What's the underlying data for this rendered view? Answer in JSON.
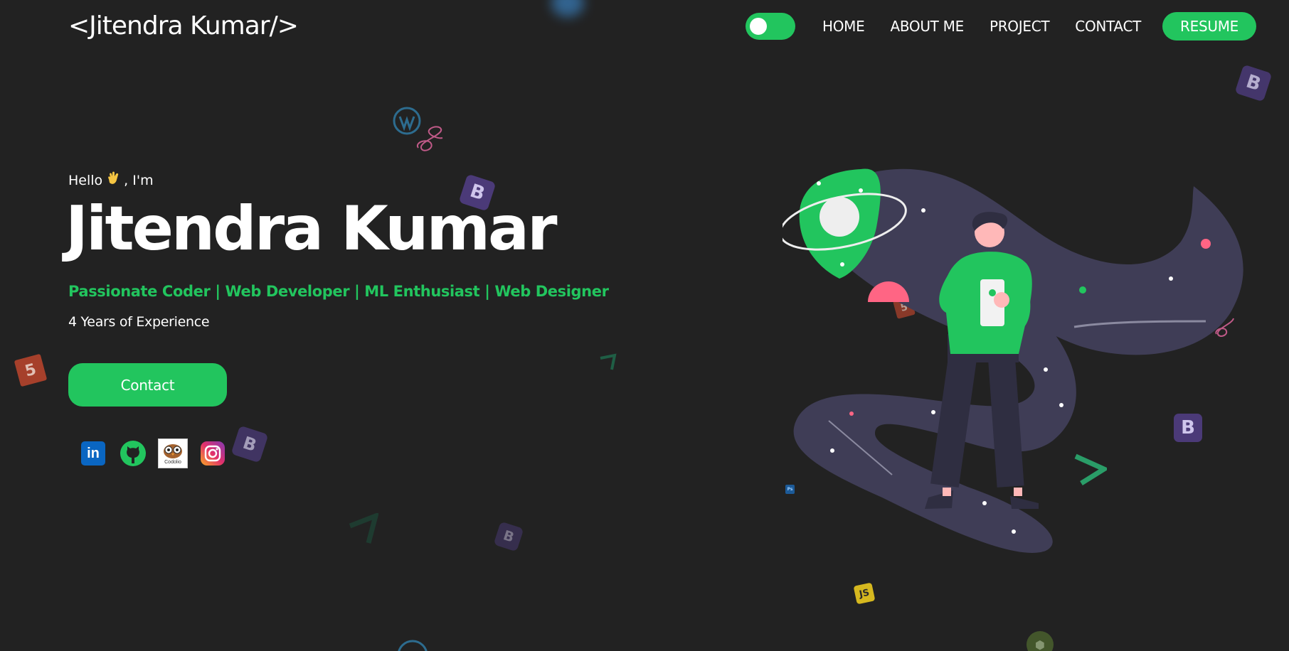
{
  "header": {
    "logo": "<Jitendra Kumar/>",
    "nav_items": [
      "HOME",
      "ABOUT ME",
      "PROJECT",
      "CONTACT"
    ],
    "resume_label": "RESUME"
  },
  "hero": {
    "greeting_prefix": "Hello",
    "greeting_suffix": ", I'm",
    "name": "Jitendra Kumar",
    "tagline": "Passionate Coder | Web Developer | ML Enthusiast | Web Designer",
    "experience": "4 Years of Experience",
    "contact_label": "Contact"
  },
  "socials": {
    "linkedin_glyph": "in",
    "codolio_label": "Codolio"
  },
  "floating_icons": {
    "bootstrap": "B",
    "html5": "5",
    "javascript": "JS",
    "photoshop": "Ps"
  },
  "theme": {
    "background": "#222222",
    "accent": "#22c55e",
    "text": "#ffffff",
    "illustration_blob": "#3f3d56",
    "pink": "#ff6584"
  },
  "icons": [
    "theme-toggle",
    "linkedin-icon",
    "github-icon",
    "codolio-icon",
    "instagram-icon",
    "bootstrap-icon",
    "html5-icon",
    "javascript-icon",
    "wordpress-icon",
    "sass-icon",
    "vue-icon"
  ]
}
